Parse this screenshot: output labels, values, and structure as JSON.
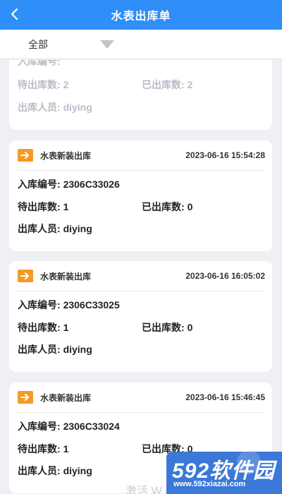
{
  "header": {
    "title": "水表出库单"
  },
  "filter": {
    "selected": "全部"
  },
  "labels": {
    "inbound_no": "入库编号: ",
    "pending": "待出库数: ",
    "shipped": "已出库数: ",
    "operator": "出库人员: "
  },
  "partial_card": {
    "pending": "2",
    "shipped": "2",
    "operator": "diying"
  },
  "records": [
    {
      "type": "水表新装出库",
      "time": "2023-06-16 15:54:28",
      "inbound_no": "2306C33026",
      "pending": "1",
      "shipped": "0",
      "operator": "diying"
    },
    {
      "type": "水表新装出库",
      "time": "2023-06-16 16:05:02",
      "inbound_no": "2306C33025",
      "pending": "1",
      "shipped": "0",
      "operator": "diying"
    },
    {
      "type": "水表新装出库",
      "time": "2023-06-16 15:46:45",
      "inbound_no": "2306C33024",
      "pending": "1",
      "shipped": "0",
      "operator": "diying"
    }
  ],
  "overlay": {
    "activate_text": "激活 W",
    "watermark_big": "592软件园",
    "watermark_small": "www.592xiazai.com"
  },
  "colors": {
    "header": "#2f8ef7",
    "badge": "#f39a28",
    "background": "#eef0f3"
  }
}
